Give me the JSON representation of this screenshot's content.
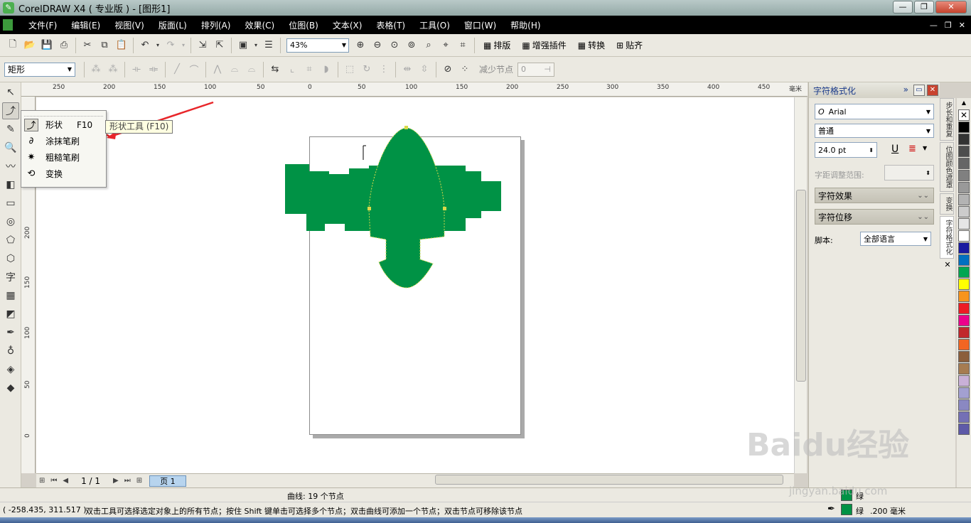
{
  "window": {
    "title": "CorelDRAW X4 ( 专业版 ) - [图形1]"
  },
  "menu": [
    "文件(F)",
    "编辑(E)",
    "视图(V)",
    "版面(L)",
    "排列(A)",
    "效果(C)",
    "位图(B)",
    "文本(X)",
    "表格(T)",
    "工具(O)",
    "窗口(W)",
    "帮助(H)"
  ],
  "toolbar": {
    "zoom": "43%",
    "text_buttons": [
      "排版",
      "增强插件",
      "转换",
      "贴齐"
    ]
  },
  "property_bar": {
    "shape_select": "矩形",
    "reduce_nodes_label": "减少节点",
    "reduce_nodes_value": "0"
  },
  "ruler": {
    "h_ticks": [
      "250",
      "200",
      "150",
      "100",
      "50",
      "0",
      "50",
      "100",
      "150",
      "200",
      "250",
      "300",
      "350",
      "400",
      "450"
    ],
    "h_unit": "毫米",
    "v_ticks": [
      "250",
      "200",
      "150",
      "100",
      "50",
      "0"
    ]
  },
  "flyout": {
    "items": [
      {
        "label": "形状",
        "shortcut": "F10",
        "icon": "shape-tool-icon"
      },
      {
        "label": "涂抹笔刷",
        "icon": "smudge-brush-icon"
      },
      {
        "label": "粗糙笔刷",
        "icon": "roughen-brush-icon"
      },
      {
        "label": "变换",
        "icon": "transform-icon"
      }
    ],
    "tooltip": "形状工具 (F10)"
  },
  "docker": {
    "title": "字符格式化",
    "font": "Arial",
    "style": "普通",
    "size": "24.0 pt",
    "kerning_label": "字距调整范围:",
    "section_effects": "字符效果",
    "section_shift": "字符位移",
    "script_label": "脚本:",
    "script_value": "全部语言"
  },
  "vtabs": [
    "步长和重复",
    "位图颜色遮罩",
    "变换",
    "字符格式化"
  ],
  "palette": [
    "#ffffff",
    "#000000",
    "#333333",
    "#4d4d4d",
    "#666666",
    "#808080",
    "#999999",
    "#b3b3b3",
    "#cccccc",
    "#e6e6e6",
    "#ffffff",
    "#1a1aa0",
    "#0070c0",
    "#00a651",
    "#ffff00",
    "#f7941d",
    "#ed1c24",
    "#ec008c",
    "#c1272d",
    "#f26522",
    "#8b5e3c",
    "#a67c52",
    "#c9b0d8",
    "#a3a0d1",
    "#8a88c2",
    "#7470b5",
    "#5e5aa8"
  ],
  "pagenav": {
    "count": "1 / 1",
    "tab": "页 1"
  },
  "status": {
    "object_info": "曲线: 19 个节点",
    "coords": "( -258.435, 311.517 )",
    "hint": "双击工具可选择选定对象上的所有节点；按住 Shift 键单击可选择多个节点；双击曲线可添加一个节点；双击节点可移除该节点",
    "fill_label": "绿",
    "outline_label": "绿",
    "outline_width": ".200 毫米"
  },
  "colors": {
    "shape_fill": "#009245",
    "menubar_bg": "#000000"
  },
  "watermark": {
    "logo": "Baidu经验",
    "url": "jingyan.baidu.com"
  }
}
